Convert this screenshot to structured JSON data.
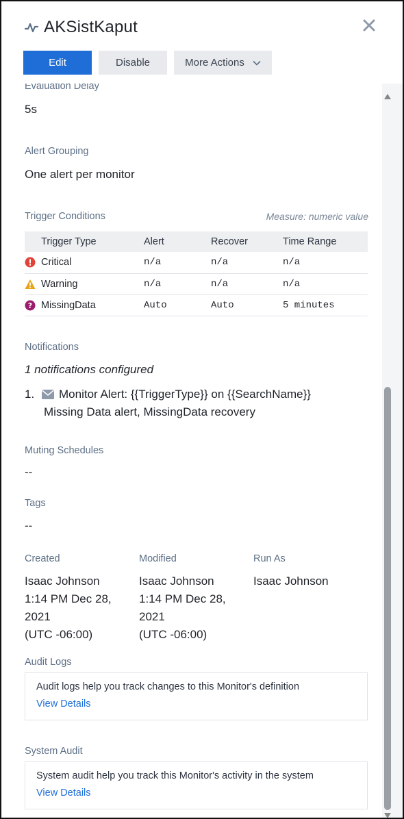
{
  "header": {
    "title": "AKSistKaput",
    "icon": "pulse-icon",
    "buttons": {
      "edit": "Edit",
      "disable": "Disable",
      "more": "More Actions"
    },
    "colors": {
      "primary": "#1f6ed8"
    }
  },
  "evaluation_delay": {
    "label": "Evaluation Delay",
    "value": "5s"
  },
  "alert_grouping": {
    "label": "Alert Grouping",
    "value": "One alert per monitor"
  },
  "trigger_conditions": {
    "label": "Trigger Conditions",
    "measure": "Measure: numeric value",
    "headers": {
      "type": "Trigger Type",
      "alert": "Alert",
      "recover": "Recover",
      "range": "Time Range"
    },
    "rows": [
      {
        "type": "Critical",
        "alert": "n/a",
        "recover": "n/a",
        "range": "n/a",
        "icon": "critical-icon",
        "color": "#e0433a"
      },
      {
        "type": "Warning",
        "alert": "n/a",
        "recover": "n/a",
        "range": "n/a",
        "icon": "warning-icon",
        "color": "#e8a317"
      },
      {
        "type": "MissingData",
        "alert": "Auto",
        "recover": "Auto",
        "range": "5 minutes",
        "icon": "missing-data-icon",
        "color": "#9b1c6d"
      }
    ]
  },
  "notifications": {
    "label": "Notifications",
    "count_text": "1 notifications configured",
    "items": [
      {
        "num": "1.",
        "icon": "mail-icon",
        "title": "Monitor Alert: {{TriggerType}} on {{SearchName}}",
        "subtitle": "Missing Data alert, MissingData recovery"
      }
    ]
  },
  "muting": {
    "label": "Muting Schedules",
    "value": "--"
  },
  "tags": {
    "label": "Tags",
    "value": "--"
  },
  "meta": {
    "created": {
      "label": "Created",
      "lines": [
        "Isaac Johnson",
        "1:14 PM Dec 28,",
        "2021",
        "(UTC -06:00)"
      ]
    },
    "modified": {
      "label": "Modified",
      "lines": [
        "Isaac Johnson",
        "1:14 PM Dec 28,",
        "2021",
        "(UTC -06:00)"
      ]
    },
    "run_as": {
      "label": "Run As",
      "lines": [
        "Isaac Johnson"
      ]
    }
  },
  "audit_logs": {
    "label": "Audit Logs",
    "text": "Audit logs help you track changes to this Monitor's definition",
    "link": "View Details"
  },
  "system_audit": {
    "label": "System Audit",
    "text": "System audit help you track this Monitor's activity in the system",
    "link": "View Details"
  }
}
